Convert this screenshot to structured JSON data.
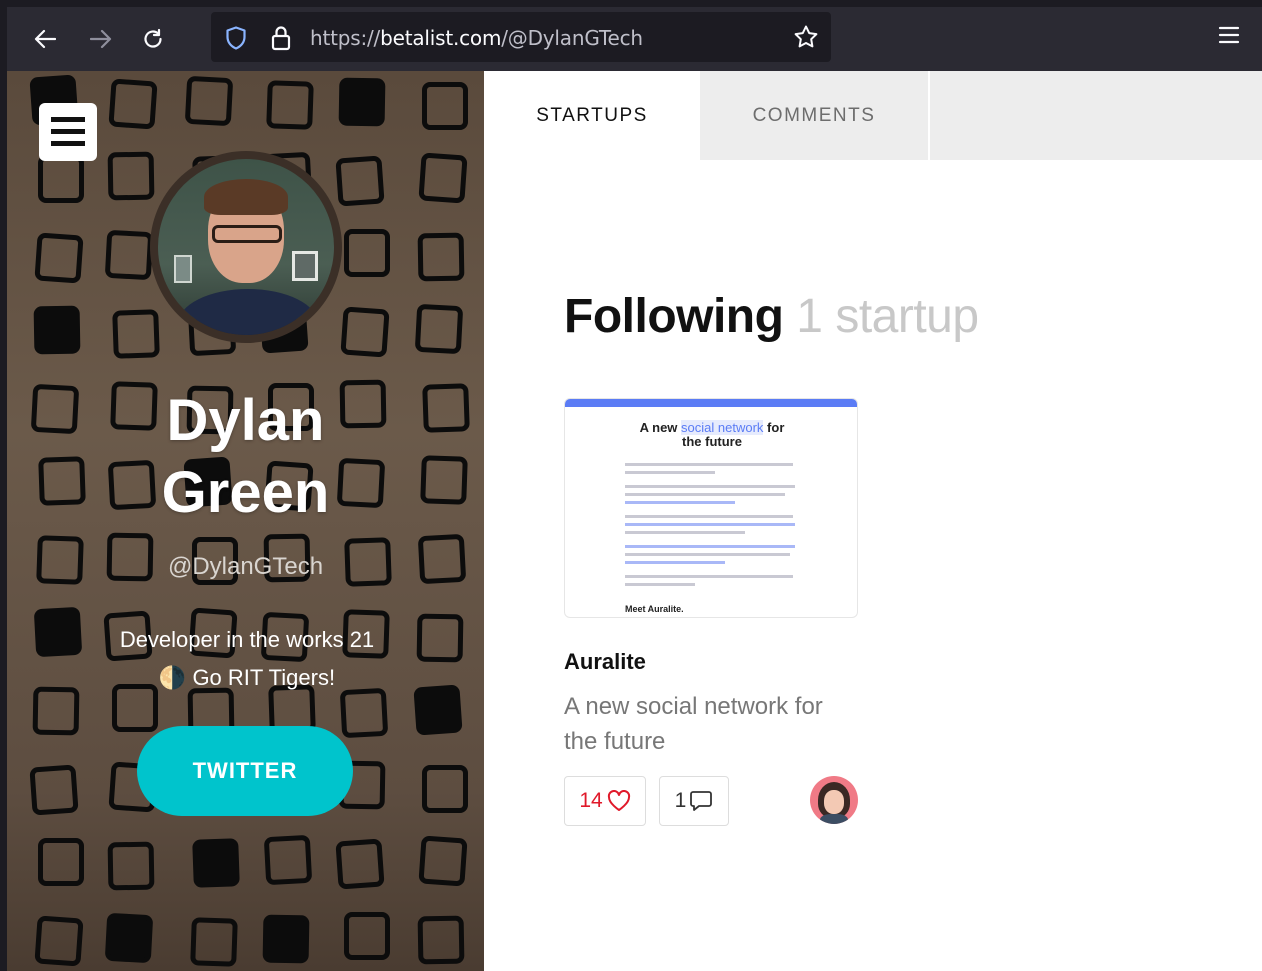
{
  "browser": {
    "url_scheme": "https://",
    "url_host": "betalist.com",
    "url_path": "/@DylanGTech"
  },
  "profile": {
    "name_line1": "Dylan",
    "name_line2": "Green",
    "handle": "@DylanGTech",
    "bio_line1": "Developer in the works 21",
    "bio_line2": "Go RIT Tigers!",
    "bio_emoji": "🌗",
    "twitter_label": "TWITTER",
    "accent_color": "#00c4cc"
  },
  "tabs": [
    {
      "label": "STARTUPS",
      "active": true
    },
    {
      "label": "COMMENTS",
      "active": false
    }
  ],
  "following": {
    "heading": "Following",
    "count_text": "1 startup"
  },
  "startups": [
    {
      "name": "Auralite",
      "description": "A new social network for the future",
      "likes": "14",
      "comments": "1",
      "thumb_title_pre": "A new",
      "thumb_title_hl": "social network",
      "thumb_title_post": "for",
      "thumb_title_line2": "the future",
      "thumb_footer": "Meet Auralite."
    }
  ]
}
